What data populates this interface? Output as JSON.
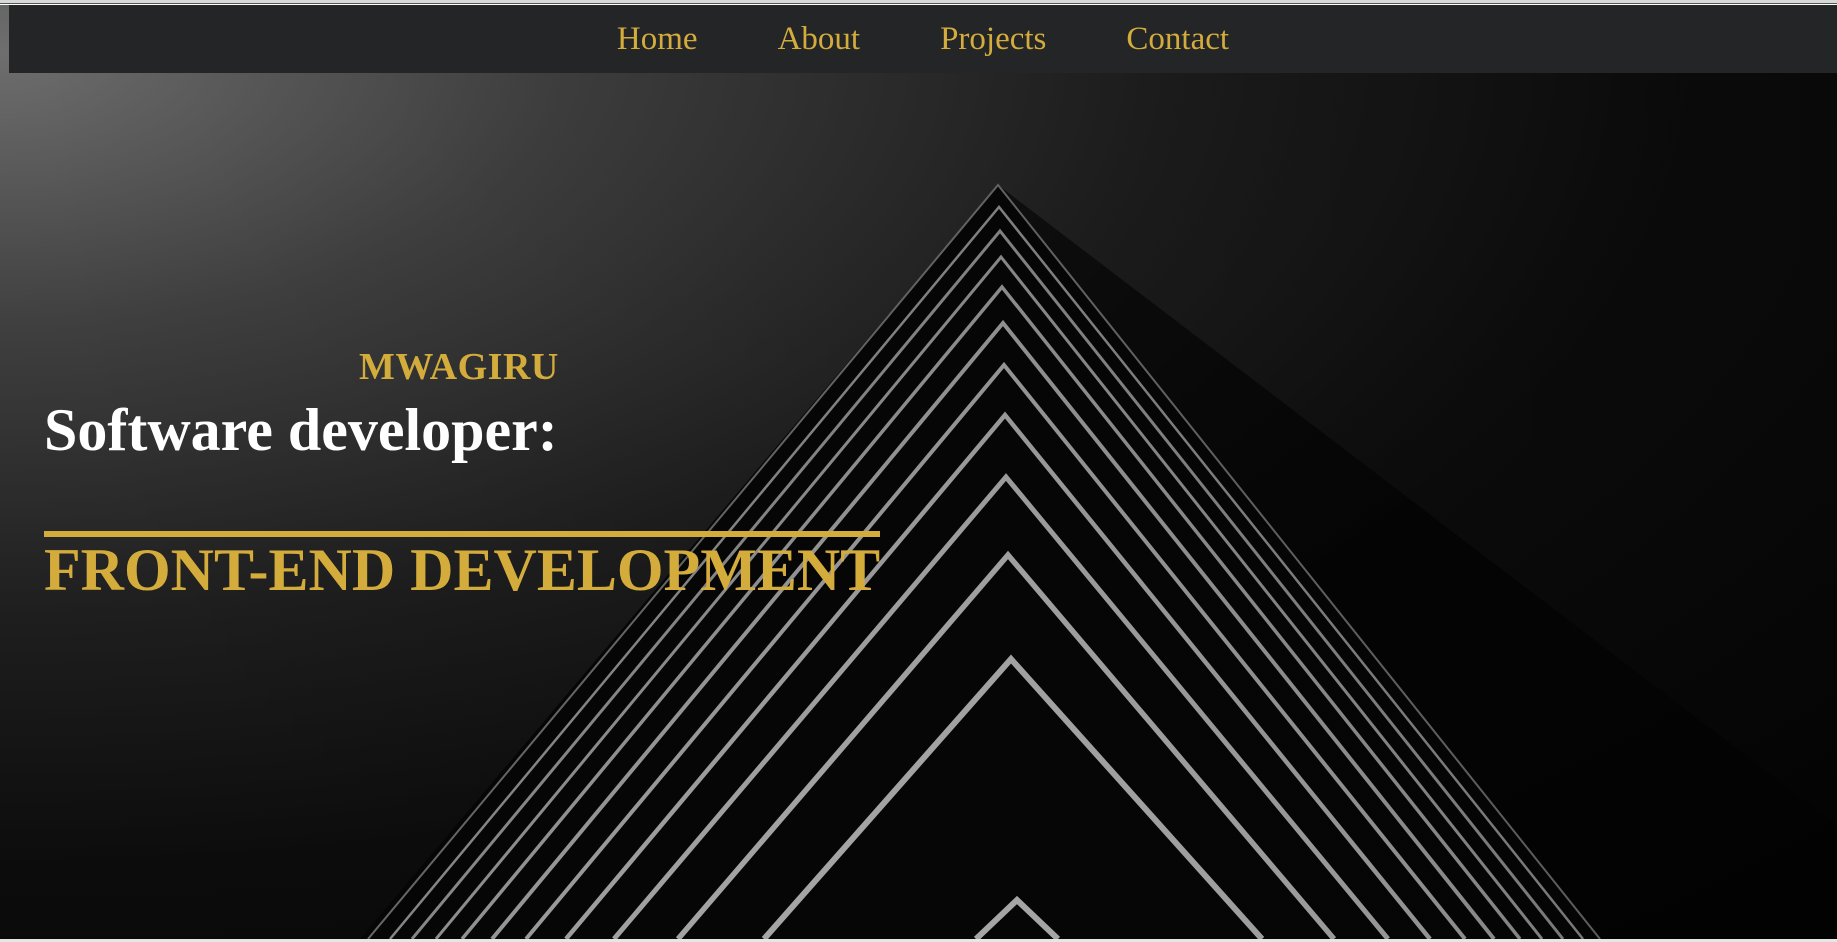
{
  "nav": {
    "items": [
      {
        "label": "Home"
      },
      {
        "label": "About"
      },
      {
        "label": "Projects"
      },
      {
        "label": "Contact"
      }
    ]
  },
  "hero": {
    "brand": "MWAGIRU",
    "headline": "Software developer:",
    "specialty": "FRONT-END DEVELOPMENT",
    "background_image": "dark-pyramid-building-photo"
  },
  "colors": {
    "accent": "#d4ac3c",
    "navbar_bg": "#242526",
    "headline_text": "#ffffff"
  }
}
